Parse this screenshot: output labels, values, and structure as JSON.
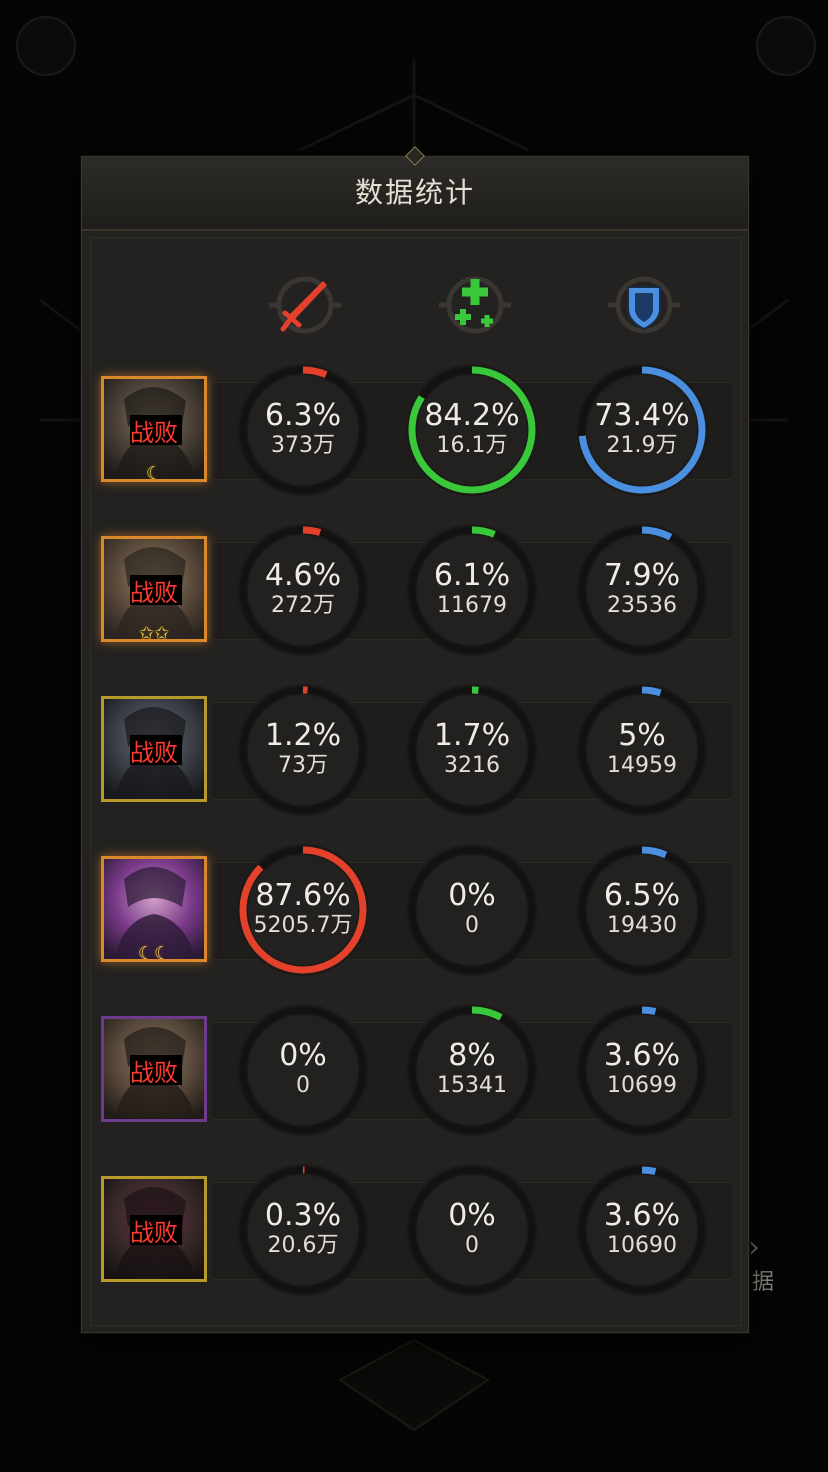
{
  "panel": {
    "title": "数据统计"
  },
  "background": {
    "side_label": "据"
  },
  "columns": [
    {
      "icon": "sword-icon",
      "color": "#e3412b"
    },
    {
      "icon": "heal-plus-icon",
      "color": "#39c83a"
    },
    {
      "icon": "shield-icon",
      "color": "#4a8fe0"
    }
  ],
  "colors": {
    "damage": "#e3412b",
    "heal": "#39c83a",
    "shield": "#4a8fe0",
    "ring_track": "#131211"
  },
  "heroes": [
    {
      "status": "战败",
      "frame": "orange",
      "stars": "☾",
      "stats": [
        {
          "percent": "6.3%",
          "value": "373万",
          "fraction": 0.063
        },
        {
          "percent": "84.2%",
          "value": "16.1万",
          "fraction": 0.842
        },
        {
          "percent": "73.4%",
          "value": "21.9万",
          "fraction": 0.734
        }
      ]
    },
    {
      "status": "战败",
      "frame": "orange",
      "stars": "✩✩",
      "stats": [
        {
          "percent": "4.6%",
          "value": "272万",
          "fraction": 0.046
        },
        {
          "percent": "6.1%",
          "value": "11679",
          "fraction": 0.061
        },
        {
          "percent": "7.9%",
          "value": "23536",
          "fraction": 0.079
        }
      ]
    },
    {
      "status": "战败",
      "frame": "gold",
      "stars": "",
      "stats": [
        {
          "percent": "1.2%",
          "value": "73万",
          "fraction": 0.012
        },
        {
          "percent": "1.7%",
          "value": "3216",
          "fraction": 0.017
        },
        {
          "percent": "5%",
          "value": "14959",
          "fraction": 0.05
        }
      ]
    },
    {
      "status": "",
      "frame": "orange",
      "stars": "☾☾",
      "stats": [
        {
          "percent": "87.6%",
          "value": "5205.7万",
          "fraction": 0.876
        },
        {
          "percent": "0%",
          "value": "0",
          "fraction": 0
        },
        {
          "percent": "6.5%",
          "value": "19430",
          "fraction": 0.065
        }
      ]
    },
    {
      "status": "战败",
      "frame": "purple",
      "stars": "",
      "stats": [
        {
          "percent": "0%",
          "value": "0",
          "fraction": 0
        },
        {
          "percent": "8%",
          "value": "15341",
          "fraction": 0.08
        },
        {
          "percent": "3.6%",
          "value": "10699",
          "fraction": 0.036
        }
      ]
    },
    {
      "status": "战败",
      "frame": "gold",
      "stars": "",
      "stats": [
        {
          "percent": "0.3%",
          "value": "20.6万",
          "fraction": 0.003
        },
        {
          "percent": "0%",
          "value": "0",
          "fraction": 0
        },
        {
          "percent": "3.6%",
          "value": "10690",
          "fraction": 0.036
        }
      ]
    }
  ]
}
